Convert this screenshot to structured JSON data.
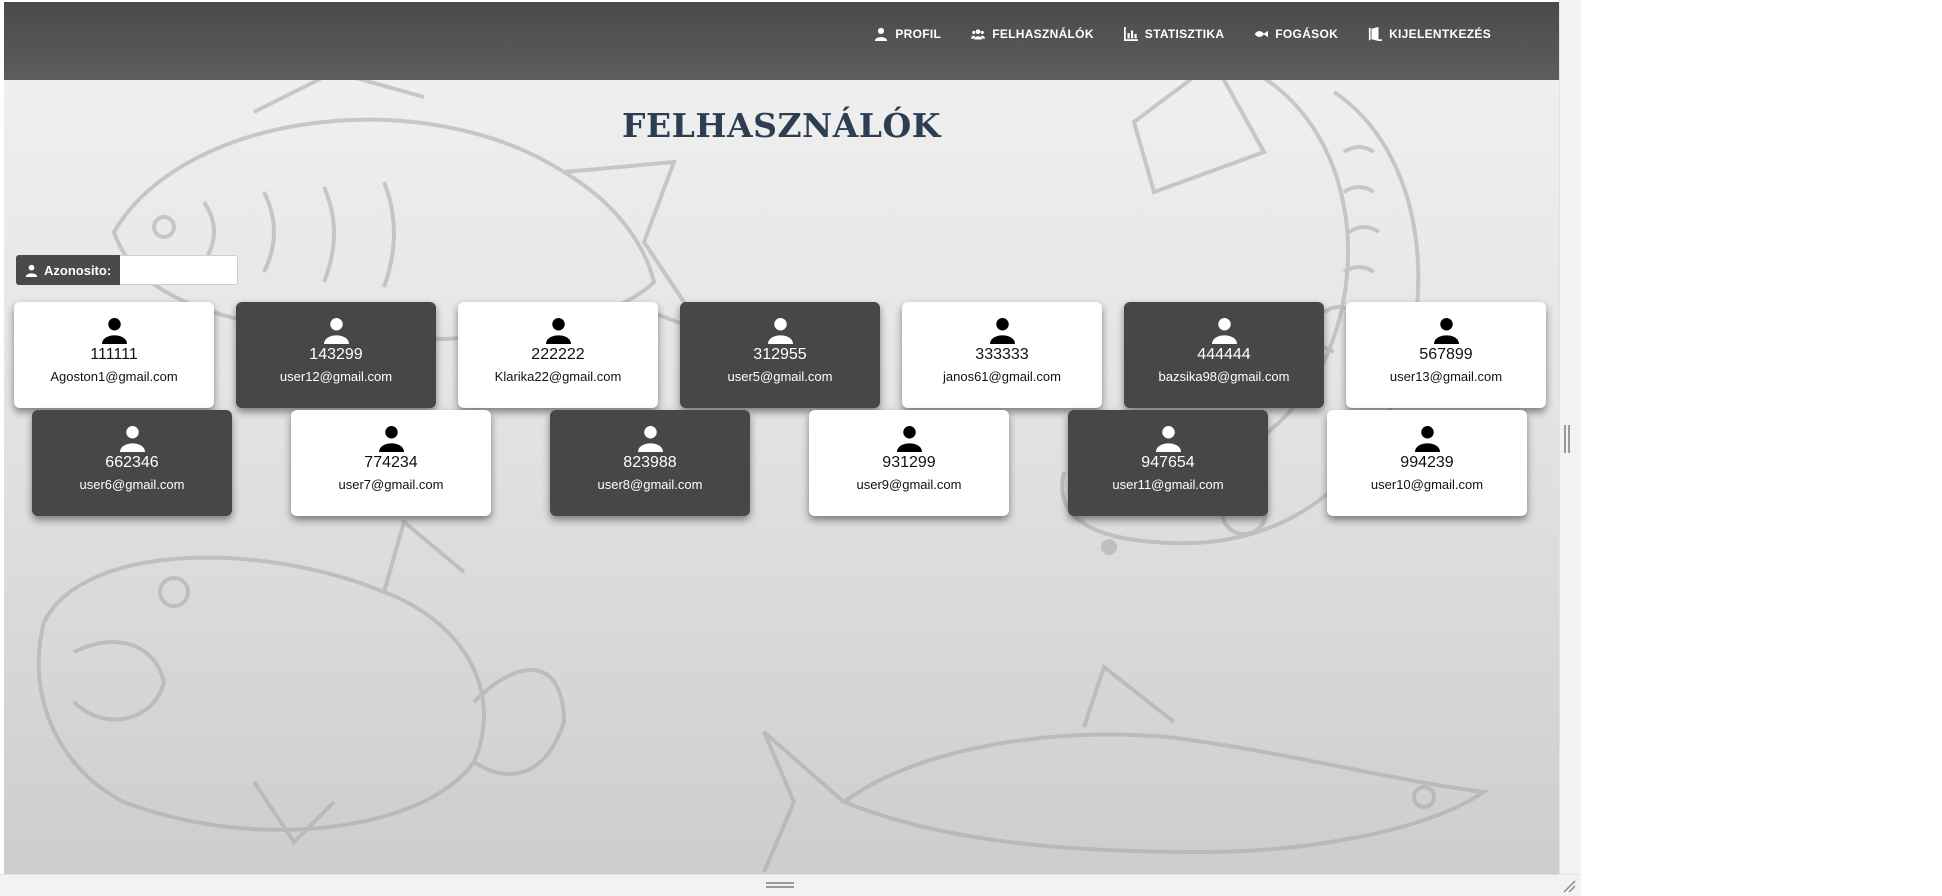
{
  "nav": {
    "items": [
      {
        "label": "PROFIL",
        "icon": "user-icon"
      },
      {
        "label": "FELHASZNÁLÓK",
        "icon": "users-icon"
      },
      {
        "label": "STATISZTIKA",
        "icon": "chart-icon"
      },
      {
        "label": "FOGÁSOK",
        "icon": "fish-icon"
      },
      {
        "label": "KIJELENTKEZÉS",
        "icon": "door-icon"
      }
    ]
  },
  "page": {
    "title": "FELHASZNÁLÓK"
  },
  "search": {
    "label": "Azonosito:",
    "value": "",
    "placeholder": ""
  },
  "users": [
    {
      "id": "111111",
      "email": "Agoston1@gmail.com",
      "theme": "light"
    },
    {
      "id": "143299",
      "email": "user12@gmail.com",
      "theme": "dark"
    },
    {
      "id": "222222",
      "email": "Klarika22@gmail.com",
      "theme": "light"
    },
    {
      "id": "312955",
      "email": "user5@gmail.com",
      "theme": "dark"
    },
    {
      "id": "333333",
      "email": "janos61@gmail.com",
      "theme": "light"
    },
    {
      "id": "444444",
      "email": "bazsika98@gmail.com",
      "theme": "dark"
    },
    {
      "id": "567899",
      "email": "user13@gmail.com",
      "theme": "light"
    },
    {
      "id": "662346",
      "email": "user6@gmail.com",
      "theme": "dark"
    },
    {
      "id": "774234",
      "email": "user7@gmail.com",
      "theme": "light"
    },
    {
      "id": "823988",
      "email": "user8@gmail.com",
      "theme": "dark"
    },
    {
      "id": "931299",
      "email": "user9@gmail.com",
      "theme": "light"
    },
    {
      "id": "947654",
      "email": "user11@gmail.com",
      "theme": "dark"
    },
    {
      "id": "994239",
      "email": "user10@gmail.com",
      "theme": "light"
    }
  ],
  "colors": {
    "navbar": "#555555",
    "title": "#2e3e52",
    "card_dark": "#474747",
    "card_light": "#ffffff"
  }
}
